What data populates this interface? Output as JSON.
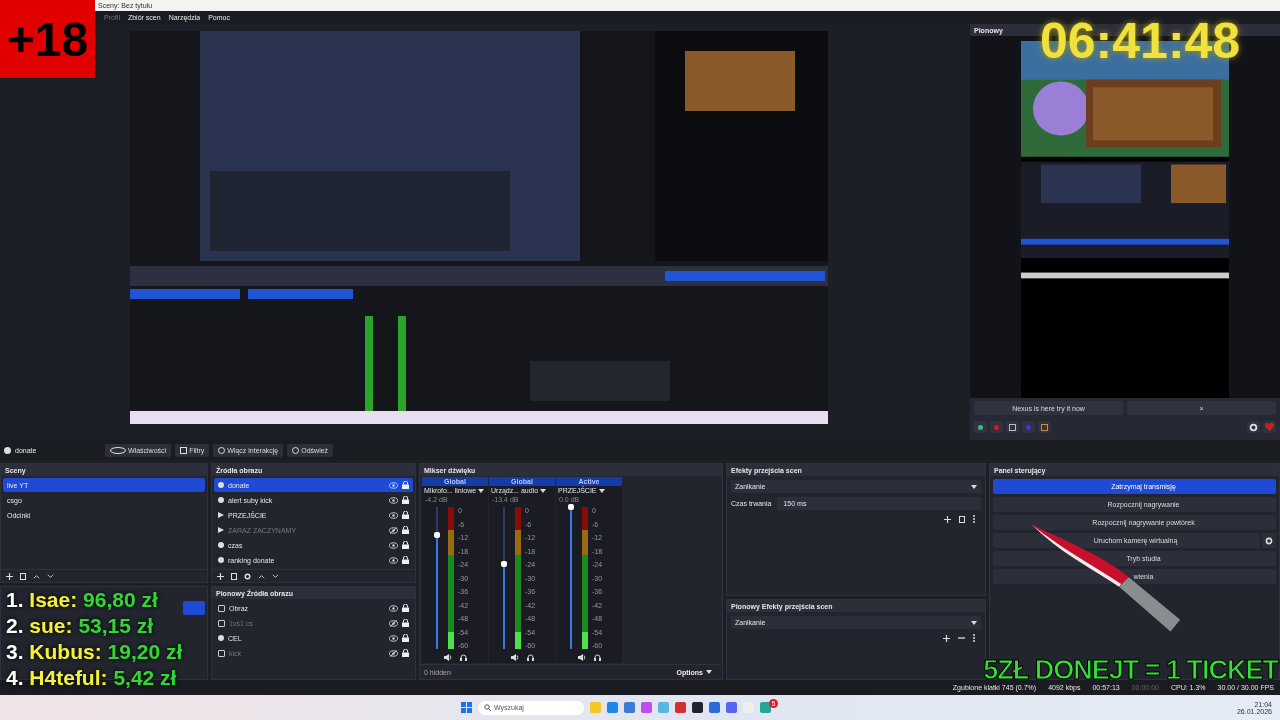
{
  "window": {
    "title": "Sceny: Bez tytułu"
  },
  "menu": [
    {
      "label": "Profil",
      "disabled": true
    },
    {
      "label": "Zbiór scen",
      "disabled": false
    },
    {
      "label": "Narzędzia",
      "disabled": false
    },
    {
      "label": "Pomoc",
      "disabled": false
    }
  ],
  "vertical_dock": {
    "title": "Pionowy",
    "banner": "Nexus is here try it now",
    "banner_close": "×"
  },
  "context_bar": {
    "source": "donate",
    "buttons": [
      {
        "label": "Właściwości",
        "kind": "gear"
      },
      {
        "label": "Filtry",
        "kind": "filter"
      },
      {
        "label": "Włącz interakcję",
        "kind": "hand"
      },
      {
        "label": "Odśwież",
        "kind": "refresh"
      }
    ]
  },
  "scenes": {
    "title": "Sceny",
    "items": [
      {
        "label": "live YT",
        "selected": true
      },
      {
        "label": "csgo",
        "selected": false
      },
      {
        "label": "Odcinki",
        "selected": false
      }
    ]
  },
  "sources": {
    "title": "Źródła obrazu",
    "items": [
      {
        "label": "donate",
        "kind": "browser",
        "visible": true,
        "selected": true
      },
      {
        "label": "alert suby kick",
        "kind": "browser",
        "visible": true,
        "selected": false
      },
      {
        "label": "PRZEJŚCIE",
        "kind": "media",
        "visible": true,
        "selected": false
      },
      {
        "label": "ZARAZ ZACZYNAMY",
        "kind": "media",
        "visible": false,
        "selected": false
      },
      {
        "label": "czas",
        "kind": "browser",
        "visible": true,
        "selected": false
      },
      {
        "label": "ranking donate",
        "kind": "browser",
        "visible": true,
        "selected": false
      }
    ]
  },
  "vertical_scenes": {
    "items": [
      {
        "selected": true
      }
    ]
  },
  "vertical_sources": {
    "title": "Pionowy Źródła obrazu",
    "items": [
      {
        "label": "Obraz",
        "visible": true,
        "selected": false
      },
      {
        "label": "1vs1 cs",
        "visible": false,
        "selected": false
      },
      {
        "label": "CEL",
        "kind": "browser",
        "visible": true,
        "selected": false
      },
      {
        "label": "kick",
        "visible": false,
        "selected": false
      }
    ]
  },
  "mixer": {
    "title": "Mikser dźwięku",
    "hidden": "0 hidden",
    "options": "Options",
    "channels": [
      {
        "tag": "Global",
        "name": "Mikrofo... liniowe",
        "reading": "-4.2 dB",
        "level": 0.8,
        "scale": [
          "0",
          "-6",
          "-12",
          "-18",
          "-24",
          "-30",
          "-36",
          "-42",
          "-48",
          "-54",
          "-60"
        ]
      },
      {
        "tag": "Global",
        "name": "Urządz... audio",
        "reading": "-13.4 dB",
        "level": 0.6,
        "scale": [
          "0",
          "-6",
          "-12",
          "-18",
          "-24",
          "-30",
          "-36",
          "-42",
          "-48",
          "-54",
          "-60"
        ]
      },
      {
        "tag": "Active",
        "name": "PRZEJŚCIE",
        "reading": "0.0 dB",
        "level": 1,
        "scale": [
          "0",
          "-6",
          "-12",
          "-18",
          "-24",
          "-30",
          "-36",
          "-42",
          "-48",
          "-54",
          "-60"
        ]
      }
    ]
  },
  "transitions": {
    "title": "Efekty przejścia scen",
    "transition": "Zanikanie",
    "duration_label": "Czas trwania",
    "duration": "150 ms"
  },
  "vertical_transitions": {
    "title": "Pionowy Efekty przejścia scen",
    "transition": "Zanikanie"
  },
  "controls": {
    "title": "Panel sterujący",
    "buttons": [
      {
        "label": "Zatrzymaj transmisję",
        "active": true,
        "settings": false
      },
      {
        "label": "Rozpocznij nagrywanie",
        "active": false,
        "settings": false
      },
      {
        "label": "Rozpocznij nagrywanie powtórek",
        "active": false,
        "settings": false
      },
      {
        "label": "Uruchom kamerę wirtualną",
        "active": false,
        "settings": true
      },
      {
        "label": "Tryb studia",
        "active": false,
        "settings": false
      },
      {
        "label": "wienia",
        "active": false,
        "settings": false
      }
    ]
  },
  "status_bar": {
    "dropped": "Zgubione klatki 745 (0.7%)",
    "bitrate": "4092 kbps",
    "stream_time": "00:57:13",
    "record_time": "00:00:00",
    "cpu": "CPU: 1.3%",
    "fps": "30.00 / 30.00 FPS"
  },
  "taskbar": {
    "search_placeholder": "Wyszukaj",
    "badge": "5",
    "time": "21:04",
    "date": "26.01.2026"
  },
  "overlay": {
    "age_badge": "+18",
    "clock": "06:41:48",
    "ticket": "5ZŁ DONEJT = 1 TICKET",
    "ranking": [
      {
        "rank": "1.",
        "name": "Isae:",
        "amount": "96,80 zł"
      },
      {
        "rank": "2.",
        "name": "sue:",
        "amount": "53,15 zł"
      },
      {
        "rank": "3.",
        "name": "Kubus:",
        "amount": "19,20 zł"
      },
      {
        "rank": "4.",
        "name": "H4teful:",
        "amount": "5,42 zł"
      }
    ]
  }
}
